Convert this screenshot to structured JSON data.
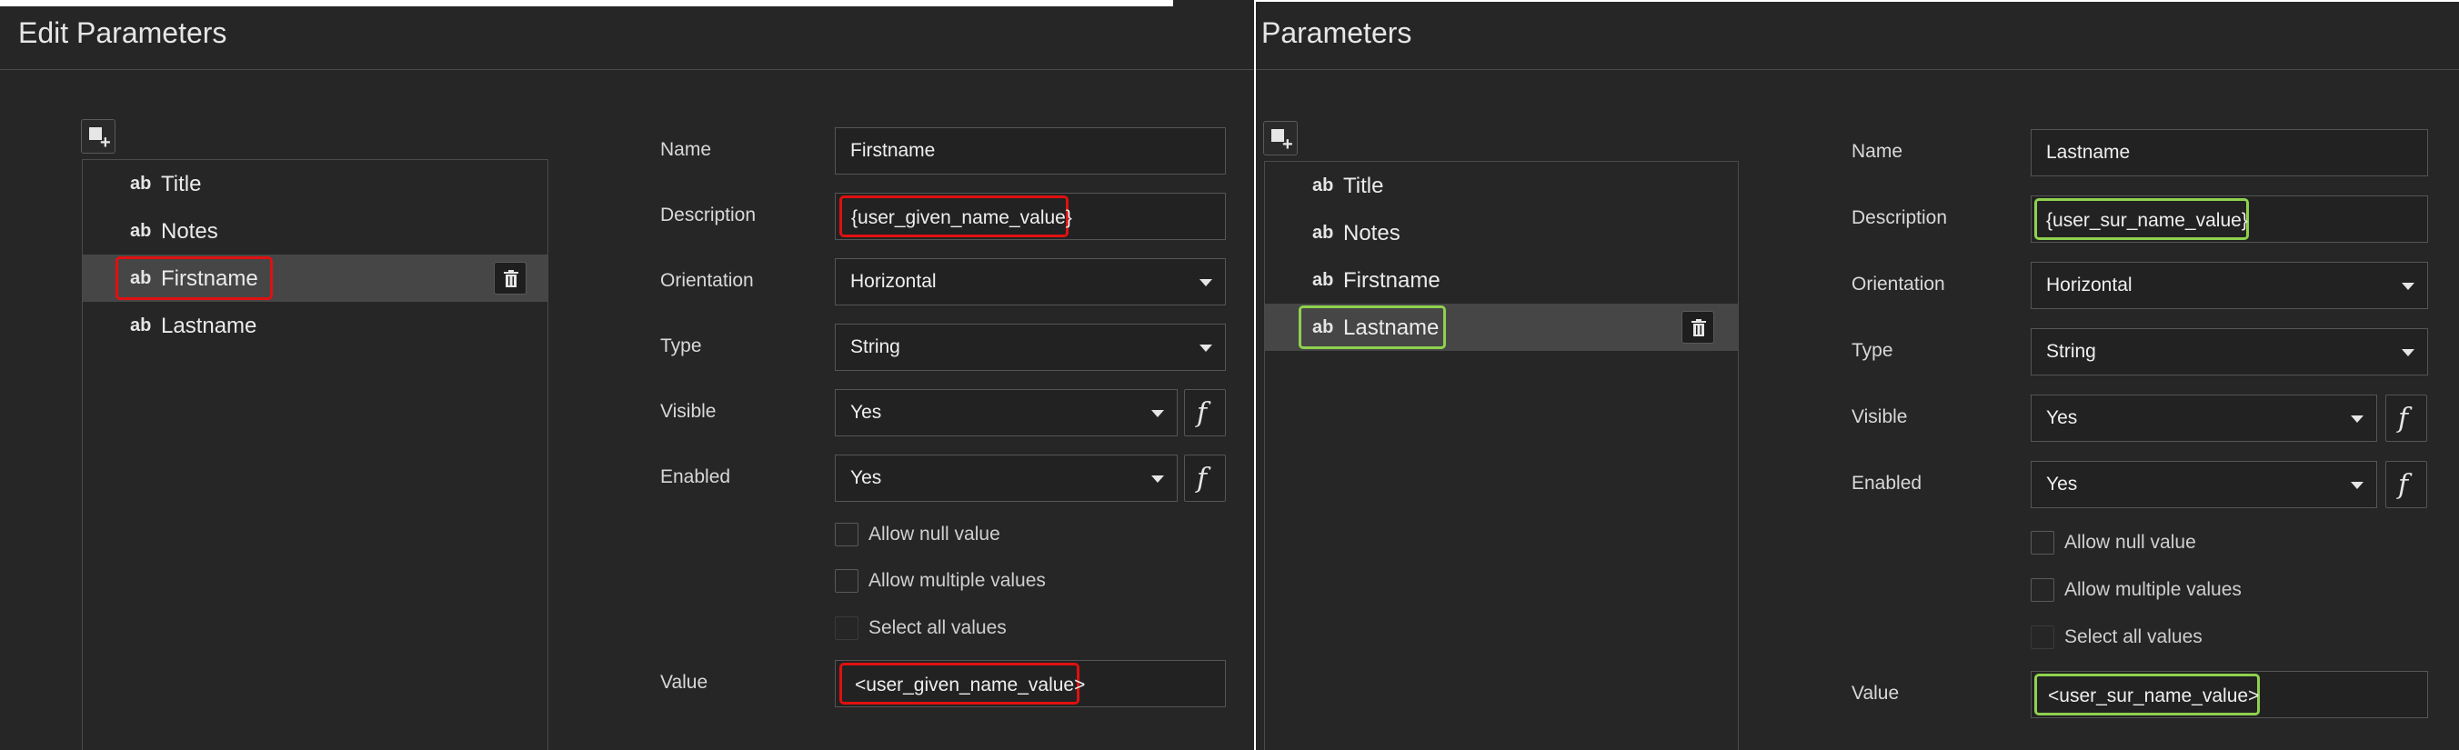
{
  "left": {
    "title": "Edit Parameters",
    "list": [
      {
        "icon": "ab",
        "label": "Title"
      },
      {
        "icon": "ab",
        "label": "Notes"
      },
      {
        "icon": "ab",
        "label": "Firstname"
      },
      {
        "icon": "ab",
        "label": "Lastname"
      }
    ],
    "form": {
      "name_label": "Name",
      "name_value": "Firstname",
      "description_label": "Description",
      "description_value": "{user_given_name_value}",
      "orientation_label": "Orientation",
      "orientation_value": "Horizontal",
      "type_label": "Type",
      "type_value": "String",
      "visible_label": "Visible",
      "visible_value": "Yes",
      "enabled_label": "Enabled",
      "enabled_value": "Yes",
      "fx": "f",
      "allow_null_label": "Allow null value",
      "allow_multiple_label": "Allow multiple values",
      "select_all_label": "Select all values",
      "value_label": "Value",
      "value_value": "<user_given_name_value>"
    },
    "highlight_color": "#e01010"
  },
  "right": {
    "title": "Parameters",
    "list": [
      {
        "icon": "ab",
        "label": "Title"
      },
      {
        "icon": "ab",
        "label": "Notes"
      },
      {
        "icon": "ab",
        "label": "Firstname"
      },
      {
        "icon": "ab",
        "label": "Lastname"
      }
    ],
    "form": {
      "name_label": "Name",
      "name_value": "Lastname",
      "description_label": "Description",
      "description_value": "{user_sur_name_value}",
      "orientation_label": "Orientation",
      "orientation_value": "Horizontal",
      "type_label": "Type",
      "type_value": "String",
      "visible_label": "Visible",
      "visible_value": "Yes",
      "enabled_label": "Enabled",
      "enabled_value": "Yes",
      "fx": "f",
      "allow_null_label": "Allow null value",
      "allow_multiple_label": "Allow multiple values",
      "select_all_label": "Select all values",
      "value_label": "Value",
      "value_value": "<user_sur_name_value>"
    },
    "highlight_color": "#8fd14f"
  }
}
